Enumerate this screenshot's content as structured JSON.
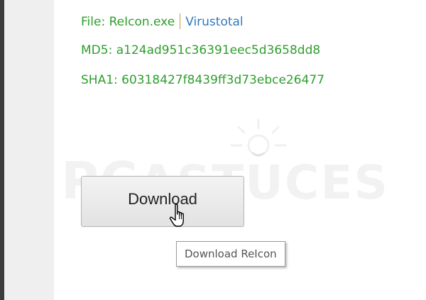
{
  "file_info": {
    "file_label": "File: ReIcon.exe",
    "virustotal_link": "Virustotal",
    "md5_line": "MD5: a124ad951c36391eec5d3658dd8",
    "sha1_line": "SHA1: 60318427f8439ff3d73ebce26477"
  },
  "watermark": {
    "brand": "PC",
    "rest": "ASTUCES"
  },
  "download_button": {
    "label": "Download"
  },
  "tooltip": {
    "text": "Download ReIcon"
  },
  "colors": {
    "info_text": "#2e9e2e",
    "link": "#2f79c0",
    "separator": "#c79a2e",
    "gutter": "#efefef",
    "left_border": "#3c3c3c"
  }
}
